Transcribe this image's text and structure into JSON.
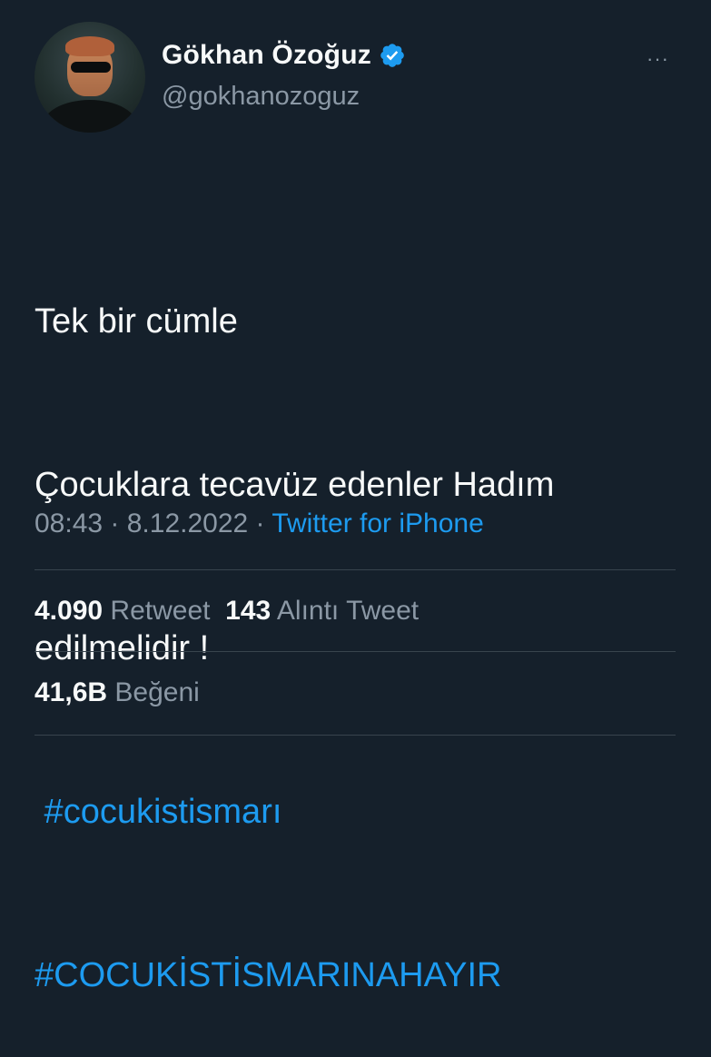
{
  "user": {
    "display_name": "Gökhan Özoğuz",
    "handle": "@gokhanozoguz",
    "verified_icon": "verified-badge-icon",
    "verified_color": "#1d9bf0"
  },
  "more_menu": {
    "label": "···"
  },
  "tweet": {
    "lines": [
      "Tek bir cümle",
      "Çocuklara tecavüz edenler Hadım",
      "edilmelidir !"
    ],
    "hashtags": [
      " #cocukistismarı",
      "#COCUKİSTİSMARINAHAYIR"
    ]
  },
  "meta": {
    "time": "08:43",
    "separator": " · ",
    "date": "8.12.2022",
    "source": "Twitter for iPhone"
  },
  "stats": {
    "retweets_count": "4.090",
    "retweets_label": "Retweet",
    "quotes_count": "143",
    "quotes_label": "Alıntı Tweet",
    "likes_count": "41,6B",
    "likes_label": "Beğeni"
  },
  "colors": {
    "background": "#15202b",
    "text": "#f7f9f9",
    "secondary": "#8b98a5",
    "accent": "#1d9bf0",
    "divider": "#38444d"
  }
}
